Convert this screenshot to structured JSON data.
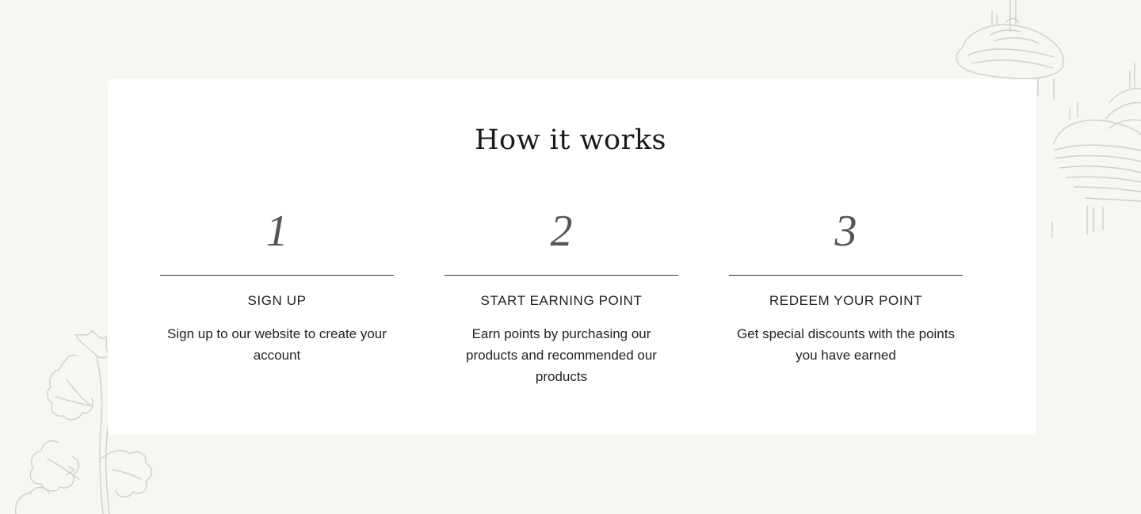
{
  "section": {
    "title": "How it works"
  },
  "steps": [
    {
      "number": "1",
      "title": "SIGN UP",
      "description": "Sign up to our website to create your account"
    },
    {
      "number": "2",
      "title": "START EARNING POINT",
      "description": "Earn points by purchasing our products and recommended our products"
    },
    {
      "number": "3",
      "title": "REDEEM YOUR POINT",
      "description": "Get special discounts with the points you have earned"
    }
  ],
  "decorations": {
    "top_right": "mushroom-illustration",
    "bottom_left": "herb-illustration"
  },
  "colors": {
    "background": "#f7f6f3",
    "card": "#ffffff",
    "text": "#222222",
    "number": "#555555",
    "line_art": "#cfcfcf"
  }
}
